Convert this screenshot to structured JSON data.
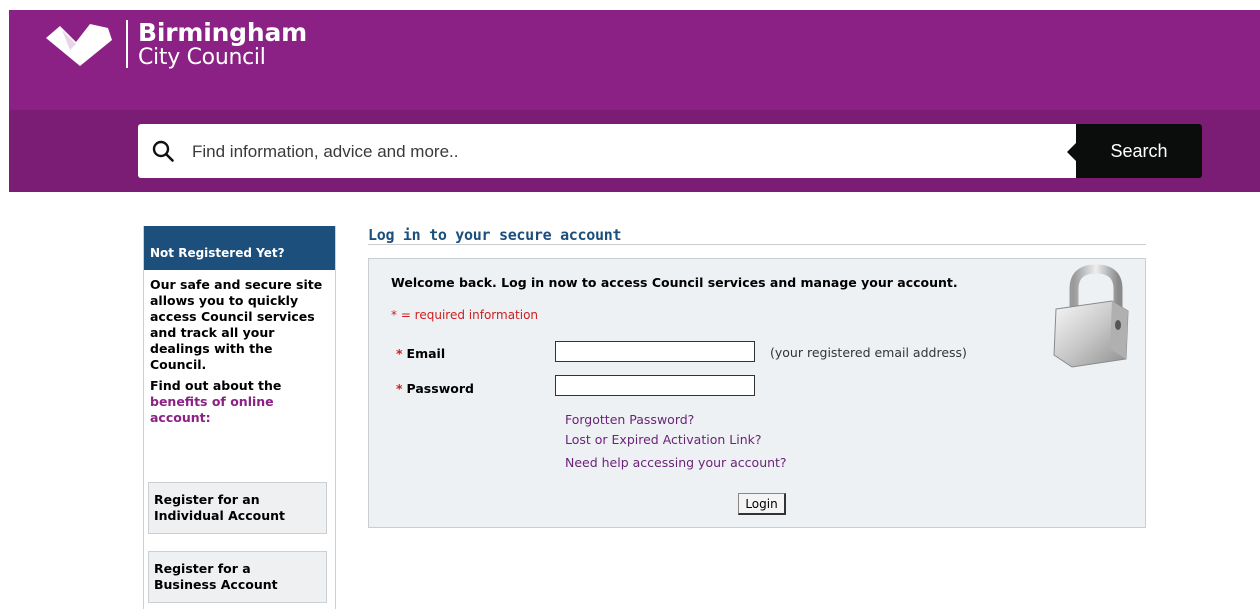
{
  "brand": {
    "line1": "Birmingham",
    "line2": "City Council",
    "color": "#8b2185"
  },
  "search": {
    "placeholder": "Find information, advice and more..",
    "button_label": "Search",
    "icon": "search-icon"
  },
  "sidebar": {
    "heading": "Not Registered Yet?",
    "intro": "Our safe and secure site allows you to quickly access Council services and track all your dealings with the Council.",
    "find_out_prefix": "Find out about the",
    "benefits_link": "benefits of online account:",
    "register_individual": {
      "line1": "Register for an",
      "line2": "Individual Account"
    },
    "register_business": {
      "line1": "Register for a",
      "line2": "Business Account"
    }
  },
  "main": {
    "title": "Log in to your secure account",
    "welcome": "Welcome back. Log in now to access Council services and manage your account.",
    "required_note": "* = required information",
    "email_label": "Email",
    "email_hint": "(your registered email address)",
    "password_label": "Password",
    "required_star": "*",
    "links": [
      "Forgotten Password?",
      "Lost or Expired Activation Link?",
      "Need help accessing your account?"
    ],
    "login_button": "Login",
    "padlock_icon": "padlock-icon"
  }
}
